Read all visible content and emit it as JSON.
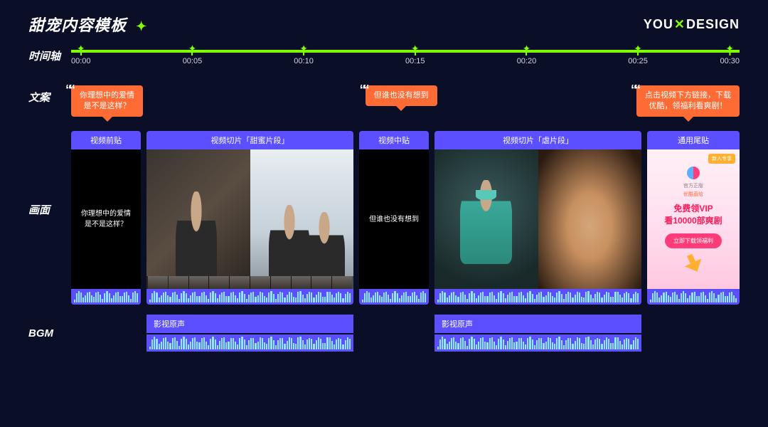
{
  "header": {
    "title": "甜宠内容模板",
    "logo_pre": "YOU",
    "logo_x": "✕",
    "logo_post": "DESIGN"
  },
  "labels": {
    "timeline": "时间轴",
    "copy": "文案",
    "visuals": "画面",
    "bgm": "BGM"
  },
  "timeline": {
    "ticks": [
      "00:00",
      "00:05",
      "00:10",
      "00:15",
      "00:20",
      "00:25",
      "00:30"
    ]
  },
  "bubbles": {
    "b1": "你理想中的爱情\n是不是这样？",
    "b2": "但谁也没有想到",
    "b3": "点击视频下方链接，下载\n优酷，领福利看爽剧！"
  },
  "clips": {
    "c1_header": "视频前贴",
    "c1_text": "你理想中的爱情\n是不是这样？",
    "c2_header": "视频切片「甜蜜片段」",
    "c3_header": "视频中贴",
    "c3_text": "但谁也没有想到",
    "c4_header": "视频切片「虐片段」",
    "c5_header": "通用尾贴"
  },
  "endcard": {
    "badge": "新人专享",
    "sub": "官方正版",
    "sub2": "优酷直给",
    "line1": "免费领VIP",
    "line2": "看10000部爽剧",
    "cta": "立即下载领福利"
  },
  "bgm": {
    "track1": "影视原声",
    "track2": "影视原声"
  }
}
